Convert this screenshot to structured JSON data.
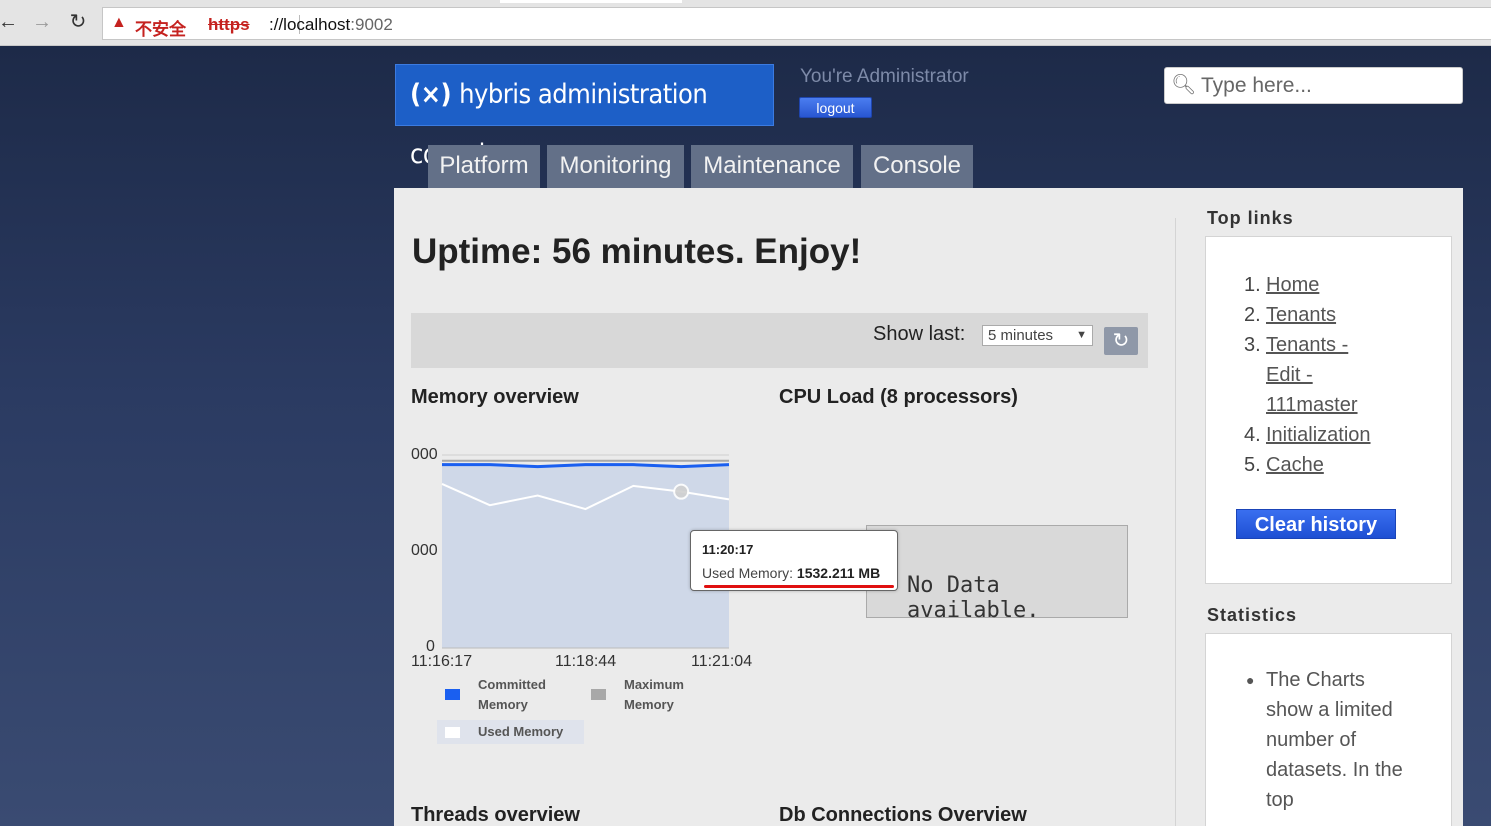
{
  "browser": {
    "warning_label": "不安全",
    "url_scheme": "https",
    "url_host": "://localhost",
    "url_port": ":9002"
  },
  "header": {
    "logo_icon": "(×)",
    "logo_text": "hybris administration console",
    "user_text": "You're Administrator",
    "logout_label": "logout",
    "search_placeholder": "Type here..."
  },
  "nav": {
    "tabs": [
      {
        "label": "Platform"
      },
      {
        "label": "Monitoring"
      },
      {
        "label": "Maintenance"
      },
      {
        "label": "Console"
      }
    ]
  },
  "main": {
    "uptime": "Uptime: 56 minutes. Enjoy!",
    "show_last_label": "Show last:",
    "show_last_value": "5 minutes",
    "memory_title": "Memory overview",
    "cpu_title": "CPU Load (8 processors)",
    "threads_title": "Threads overview",
    "db_title": "Db Connections Overview",
    "no_data": "No Data available."
  },
  "tooltip": {
    "time": "11:20:17",
    "label": "Used Memory:",
    "value": "1532.211 MB"
  },
  "sidebar": {
    "toplinks_heading": "Top links",
    "links": [
      {
        "num": "1.",
        "label": "Home"
      },
      {
        "num": "2.",
        "label": "Tenants"
      },
      {
        "num": "3.",
        "label": "Tenants - Edit - 111master"
      },
      {
        "num": "4.",
        "label": "Initialization"
      },
      {
        "num": "5.",
        "label": "Cache"
      }
    ],
    "clear_history_label": "Clear history",
    "stats_heading": "Statistics",
    "stats_text": "The Charts show a limited number of datasets. In the top"
  },
  "chart_data": {
    "type": "area",
    "title": "Memory overview",
    "x": [
      "11:16:17",
      "11:18:44",
      "11:21:04"
    ],
    "y_ticks": [
      "000",
      "000",
      "0"
    ],
    "series": [
      {
        "name": "Committed Memory",
        "color": "#1a5ff0",
        "values": [
          0.95,
          0.95,
          0.94,
          0.95,
          0.95,
          0.94,
          0.95
        ]
      },
      {
        "name": "Maximum Memory",
        "color": "#a8a8a8",
        "values": [
          0.97,
          0.97,
          0.97,
          0.97,
          0.97,
          0.97,
          0.97
        ]
      },
      {
        "name": "Used Memory",
        "color": "#ffffff",
        "values": [
          0.85,
          0.74,
          0.79,
          0.72,
          0.84,
          0.81,
          0.77
        ]
      }
    ],
    "legend": [
      "Committed Memory",
      "Maximum Memory",
      "Used Memory"
    ],
    "legend_placement": "bottom"
  }
}
